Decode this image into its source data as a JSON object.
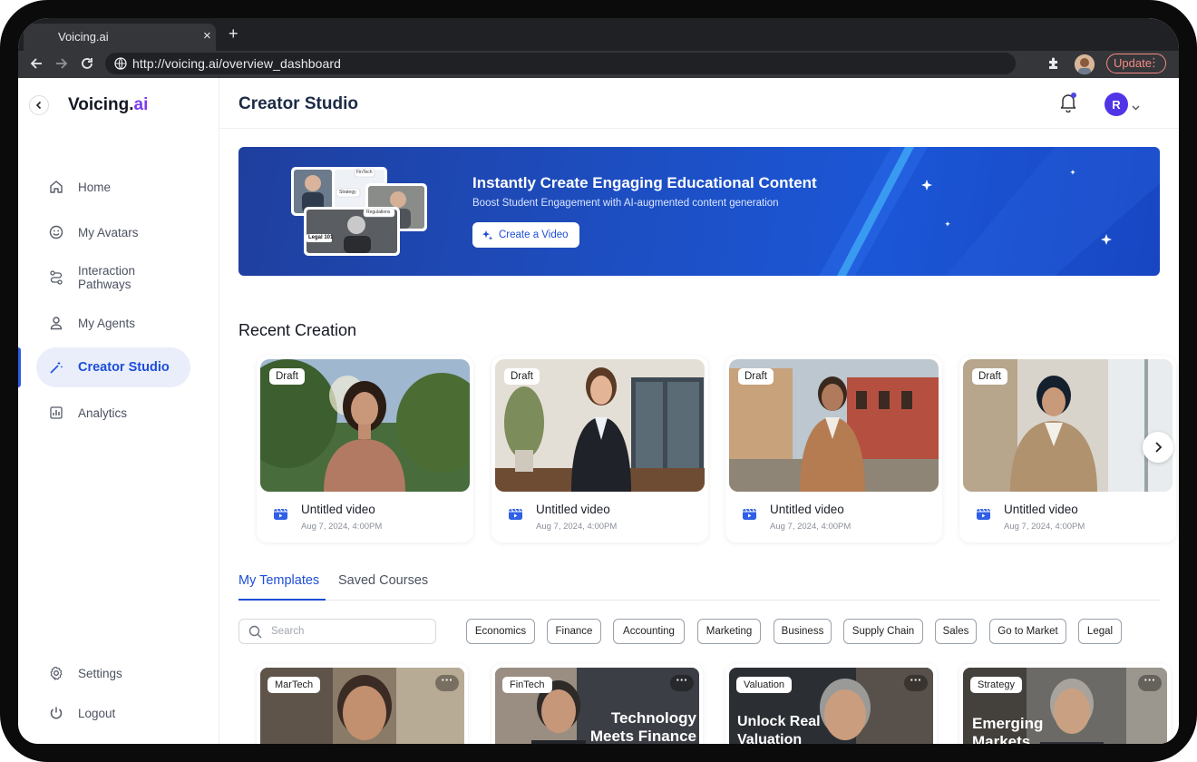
{
  "browser": {
    "tab_title": "Voicing.ai",
    "url": "http://voicing.ai/overview_dashboard",
    "update_label": "Update",
    "update_accent": "#f28b82"
  },
  "sidebar": {
    "logo_main": "Voicing",
    "logo_dot": ".",
    "logo_suffix": "ai",
    "items": [
      {
        "label": "Home",
        "icon": "home-icon"
      },
      {
        "label": "My Avatars",
        "icon": "smile-icon"
      },
      {
        "label": "Interaction Pathways",
        "icon": "route-icon"
      },
      {
        "label": "My Agents",
        "icon": "user-icon"
      },
      {
        "label": "Creator Studio",
        "icon": "magic-wand-icon",
        "active": true
      },
      {
        "label": "Analytics",
        "icon": "bar-chart-icon"
      }
    ],
    "bottom_items": [
      {
        "label": "Settings",
        "icon": "gear-icon"
      },
      {
        "label": "Logout",
        "icon": "power-icon"
      }
    ]
  },
  "header": {
    "title": "Creator Studio",
    "avatar_initial": "R"
  },
  "banner": {
    "title": "Instantly Create Engaging Educational Content",
    "subtitle": "Boost Student Engagement with AI-augmented content generation",
    "button_label": "Create a Video",
    "collage_tags": [
      "FinTech",
      "Strategy",
      "Regulations",
      "Legal 101"
    ]
  },
  "recent": {
    "title": "Recent Creation",
    "cards": [
      {
        "badge": "Draft",
        "title": "Untitled video",
        "date": "Aug 7, 2024, 4:00PM"
      },
      {
        "badge": "Draft",
        "title": "Untitled video",
        "date": "Aug 7, 2024, 4:00PM"
      },
      {
        "badge": "Draft",
        "title": "Untitled video",
        "date": "Aug 7, 2024, 4:00PM"
      },
      {
        "badge": "Draft",
        "title": "Untitled video",
        "date": "Aug 7, 2024, 4:00PM"
      }
    ]
  },
  "templates_tabs": {
    "tabs": [
      "My Templates",
      "Saved Courses"
    ],
    "active": "My Templates"
  },
  "filters": {
    "search_placeholder": "Search",
    "chips": [
      "Economics",
      "Finance",
      "Accounting",
      "Marketing",
      "Business",
      "Supply Chain",
      "Sales",
      "Go to Market",
      "Legal"
    ]
  },
  "templates": [
    {
      "tag": "MarTech",
      "headline": ""
    },
    {
      "tag": "FinTech",
      "headline": "Technology Meets Finance"
    },
    {
      "tag": "Valuation",
      "headline": "Unlock Real Valuation"
    },
    {
      "tag": "Strategy",
      "headline": "Emerging Markets"
    }
  ],
  "colors": {
    "accent": "#1d4ed8",
    "logo_ai": "#7c3aed",
    "banner_start": "#1f3f9e",
    "banner_end": "#1b56d6",
    "avatar_bg": "#4f35e6"
  }
}
